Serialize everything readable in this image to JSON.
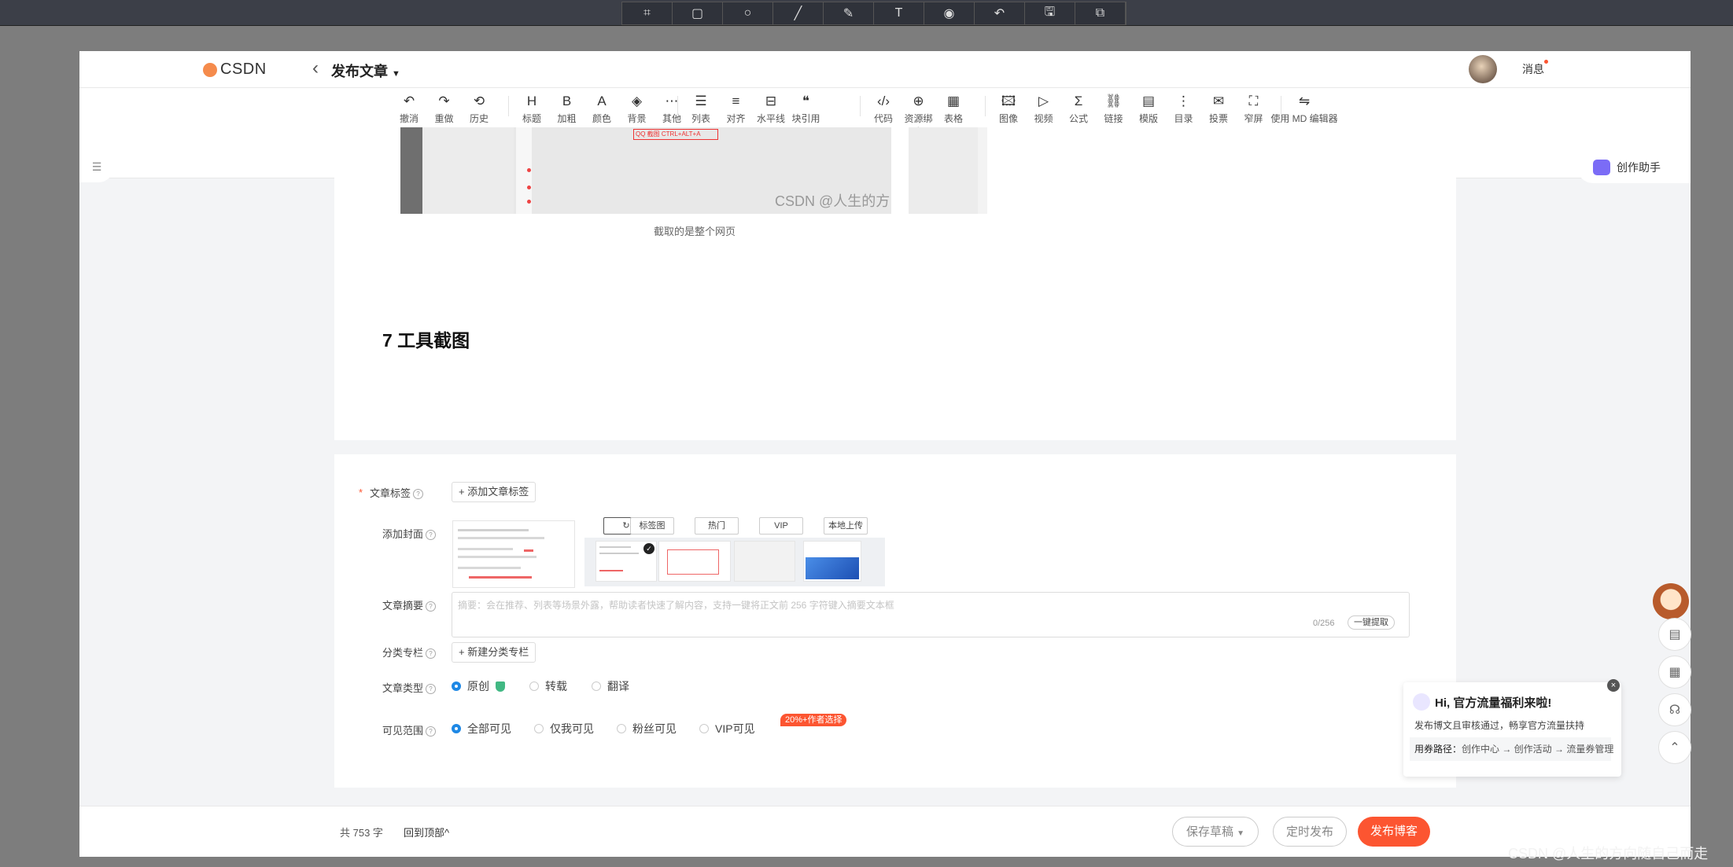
{
  "capture_toolbar": {
    "icons": [
      "crop-icon",
      "rectangle-icon",
      "ellipse-icon",
      "line-icon",
      "pen-icon",
      "text-icon",
      "fill-icon",
      "undo-icon",
      "save-icon",
      "copy-icon"
    ],
    "glyphs": [
      "⌗",
      "▢",
      "○",
      "╱",
      "✎",
      "T",
      "◉",
      "↶",
      "🖫",
      "⧉"
    ]
  },
  "header": {
    "logo": "CSDN",
    "back_glyph": "‹",
    "title": "发布文章",
    "messages": "消息"
  },
  "toolbar": {
    "groups": [
      [
        {
          "glyph": "↶",
          "label": "撤消"
        },
        {
          "glyph": "↷",
          "label": "重做"
        },
        {
          "glyph": "⟲",
          "label": "历史"
        }
      ],
      [
        {
          "glyph": "H",
          "label": "标题"
        },
        {
          "glyph": "B",
          "label": "加粗"
        },
        {
          "glyph": "A",
          "label": "颜色"
        },
        {
          "glyph": "◈",
          "label": "背景"
        },
        {
          "glyph": "⋯",
          "label": "其他"
        }
      ],
      [
        {
          "glyph": "☰",
          "label": "列表"
        },
        {
          "glyph": "≡",
          "label": "对齐"
        },
        {
          "glyph": "⊟",
          "label": "水平线"
        },
        {
          "glyph": "❝",
          "label": "块引用"
        }
      ],
      [
        {
          "glyph": "‹/›",
          "label": "代码"
        },
        {
          "glyph": "⊕",
          "label": "资源绑定"
        },
        {
          "glyph": "▦",
          "label": "表格"
        }
      ],
      [
        {
          "glyph": "🖾",
          "label": "图像"
        },
        {
          "glyph": "▷",
          "label": "视频"
        },
        {
          "glyph": "Σ",
          "label": "公式"
        },
        {
          "glyph": "⛓",
          "label": "链接"
        },
        {
          "glyph": "▤",
          "label": "模版"
        },
        {
          "glyph": "⋮",
          "label": "目录"
        },
        {
          "glyph": "✉",
          "label": "投票"
        },
        {
          "glyph": "⛶",
          "label": "窄屏"
        }
      ],
      [
        {
          "glyph": "⇋",
          "label": "使用 MD 编辑器"
        }
      ]
    ]
  },
  "content": {
    "image_caption": "截取的是整个网页",
    "watermark": "CSDN @人生的方向随自己而走",
    "qq_hint": "QQ 截图 CTRL+ALT+A",
    "heading": "7 工具截图"
  },
  "settings": {
    "tags_label": "文章标签",
    "add_tag": "+ 添加文章标签",
    "cover_label": "添加封面",
    "cover_tabs": [
      "↻",
      "标签图",
      "热门",
      "VIP",
      "本地上传"
    ],
    "summary_label": "文章摘要",
    "summary_placeholder": "摘要：会在推荐、列表等场景外露，帮助读者快速了解内容，支持一键将正文前 256 字符键入摘要文本框",
    "summary_count": "0/256",
    "summary_extract": "一键提取",
    "column_label": "分类专栏",
    "new_column": "+ 新建分类专栏",
    "type_label": "文章类型",
    "types": [
      "原创",
      "转载",
      "翻译"
    ],
    "visibility_label": "可见范围",
    "visibility": [
      "全部可见",
      "仅我可见",
      "粉丝可见",
      "VIP可见"
    ],
    "vip_badge": "20%+作者选择"
  },
  "assistant": {
    "label": "创作助手"
  },
  "promo": {
    "title": "Hi, 官方流量福利来啦!",
    "desc": "发布博文且审核通过，畅享官方流量扶持",
    "path_label": "用券路径：",
    "path": "创作中心 → 创作活动 → 流量券管理"
  },
  "footer": {
    "word_count": "共 753 字",
    "back_top": "回到顶部^",
    "save_draft": "保存草稿",
    "schedule": "定时发布",
    "publish": "发布博客"
  },
  "page_watermark": "CSDN @人生的方向随自己而走",
  "colors": {
    "accent": "#fc5531",
    "radio": "#1e88e5",
    "window_bg": "#f3f4f6"
  }
}
